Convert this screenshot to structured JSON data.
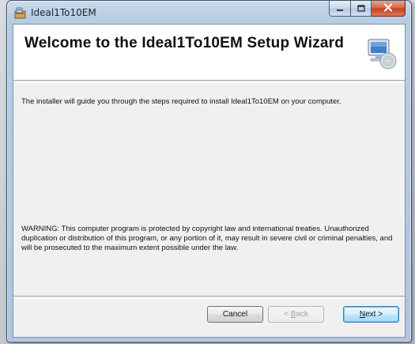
{
  "window": {
    "title": "Ideal1To10EM",
    "caption_buttons": [
      "minimize",
      "maximize",
      "close"
    ]
  },
  "banner": {
    "title": "Welcome to the Ideal1To10EM Setup Wizard",
    "icon": "computer-cd-icon"
  },
  "body": {
    "intro": "The installer will guide you through the steps required to install Ideal1To10EM on your computer.",
    "warning": "WARNING: This computer program is protected by copyright law and international treaties. Unauthorized duplication or distribution of this program, or any portion of it, may result in severe civil or criminal penalties, and will be prosecuted to the maximum extent possible under the law."
  },
  "buttons": {
    "cancel": "Cancel",
    "back_prefix": "< ",
    "back_access": "B",
    "back_rest": "ack",
    "next_access": "N",
    "next_rest": "ext >",
    "back_enabled": false
  },
  "colors": {
    "close_button": "#c5431f",
    "default_button_border": "#3c7fb1"
  }
}
